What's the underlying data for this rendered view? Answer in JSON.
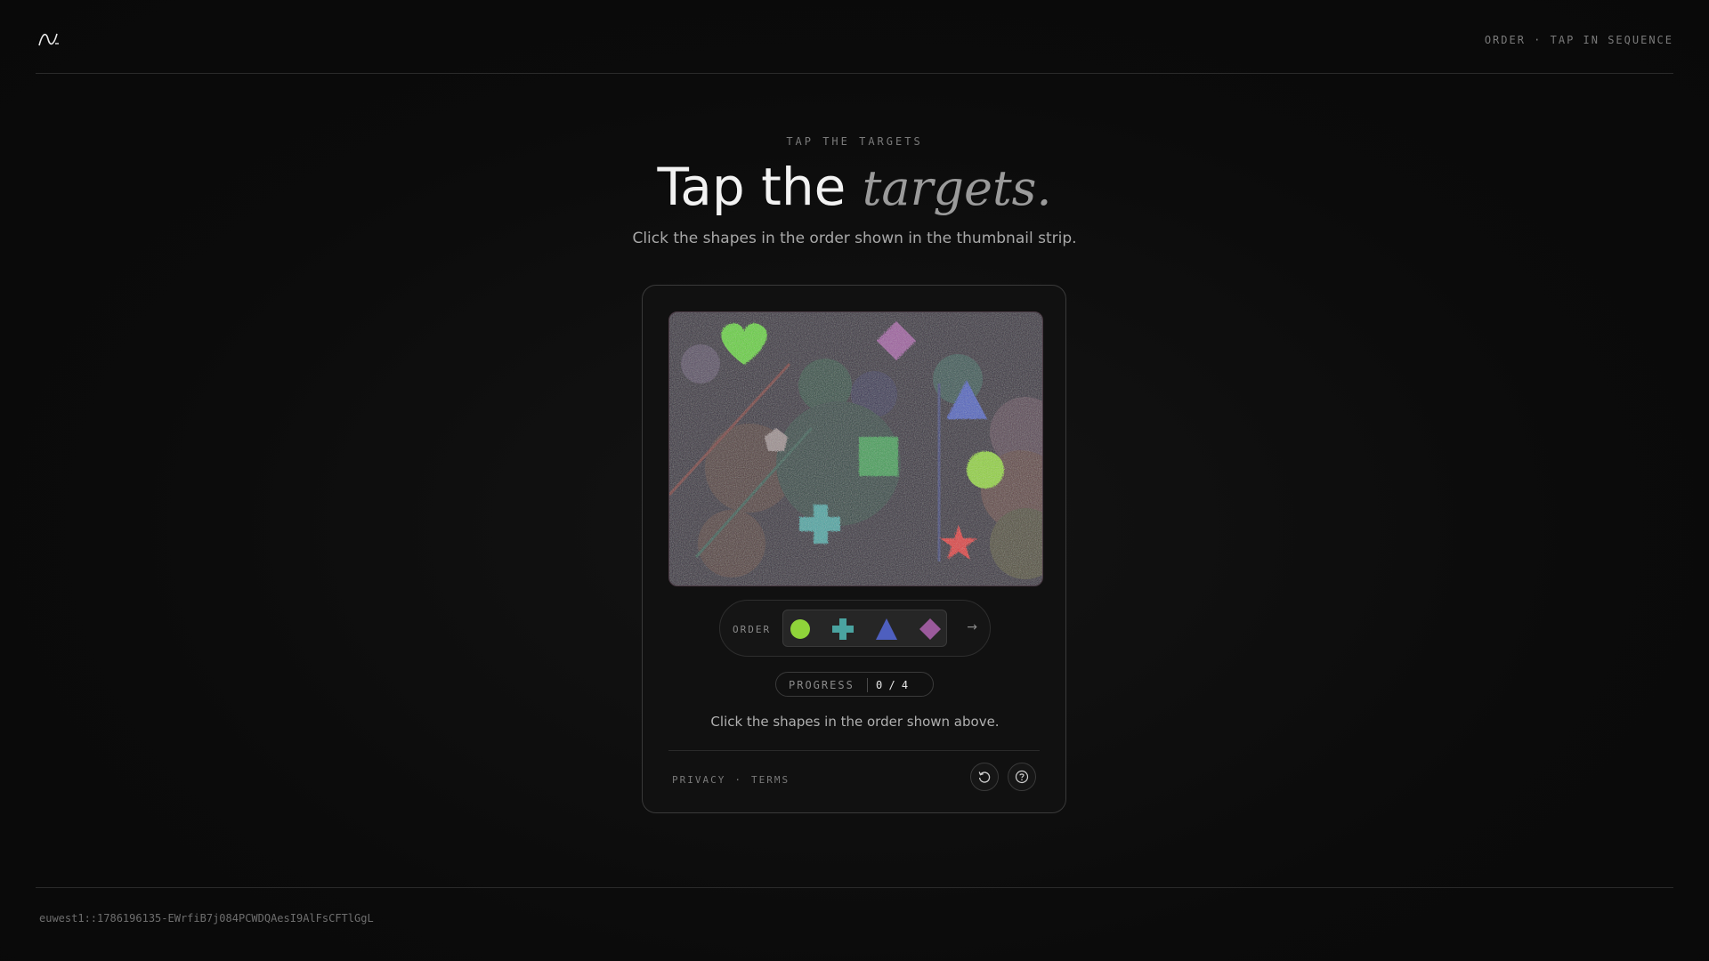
{
  "header": {
    "right_text": "ORDER · TAP IN SEQUENCE",
    "logo_icon": "wave-logo-icon"
  },
  "hero": {
    "eyebrow": "TAP THE TARGETS",
    "title_plain": "Tap the ",
    "title_accent": "targets.",
    "subtitle": "Click the shapes in the order shown in the thumbnail strip."
  },
  "challenge": {
    "stage_shapes": [
      {
        "shape": "heart",
        "color": "#62d23a"
      },
      {
        "shape": "diamond",
        "color": "#9b5a9c"
      },
      {
        "shape": "triangle",
        "color": "#4e5fbf"
      },
      {
        "shape": "pentagon",
        "color": "#9a8c8c"
      },
      {
        "shape": "square",
        "color": "#3f9c52"
      },
      {
        "shape": "circle",
        "color": "#8fd43a"
      },
      {
        "shape": "cross",
        "color": "#4aa3a0"
      },
      {
        "shape": "star",
        "color": "#e03a3a"
      }
    ],
    "order_label": "ORDER",
    "order_sequence": [
      {
        "shape": "circle",
        "color": "#8fd43a"
      },
      {
        "shape": "cross",
        "color": "#4aa3a0"
      },
      {
        "shape": "triangle",
        "color": "#4e5fbf"
      },
      {
        "shape": "diamond",
        "color": "#9b5a9c"
      }
    ],
    "order_arrow": "→",
    "progress_label": "PROGRESS",
    "progress_value": "0 / 4",
    "progress_current": 0,
    "progress_total": 4,
    "instruction": "Click the shapes in the order shown above."
  },
  "footer": {
    "privacy": "PRIVACY",
    "separator": "·",
    "terms": "TERMS",
    "refresh_icon": "refresh-icon",
    "help_icon": "help-icon"
  },
  "session_id": "euwest1::1786196135-EWrfiB7j084PCWDQAesI9AlFsCFTlGgL",
  "colors": {
    "background": "#0b0b0b",
    "card": "#111111",
    "border": "#3a3a3a"
  }
}
